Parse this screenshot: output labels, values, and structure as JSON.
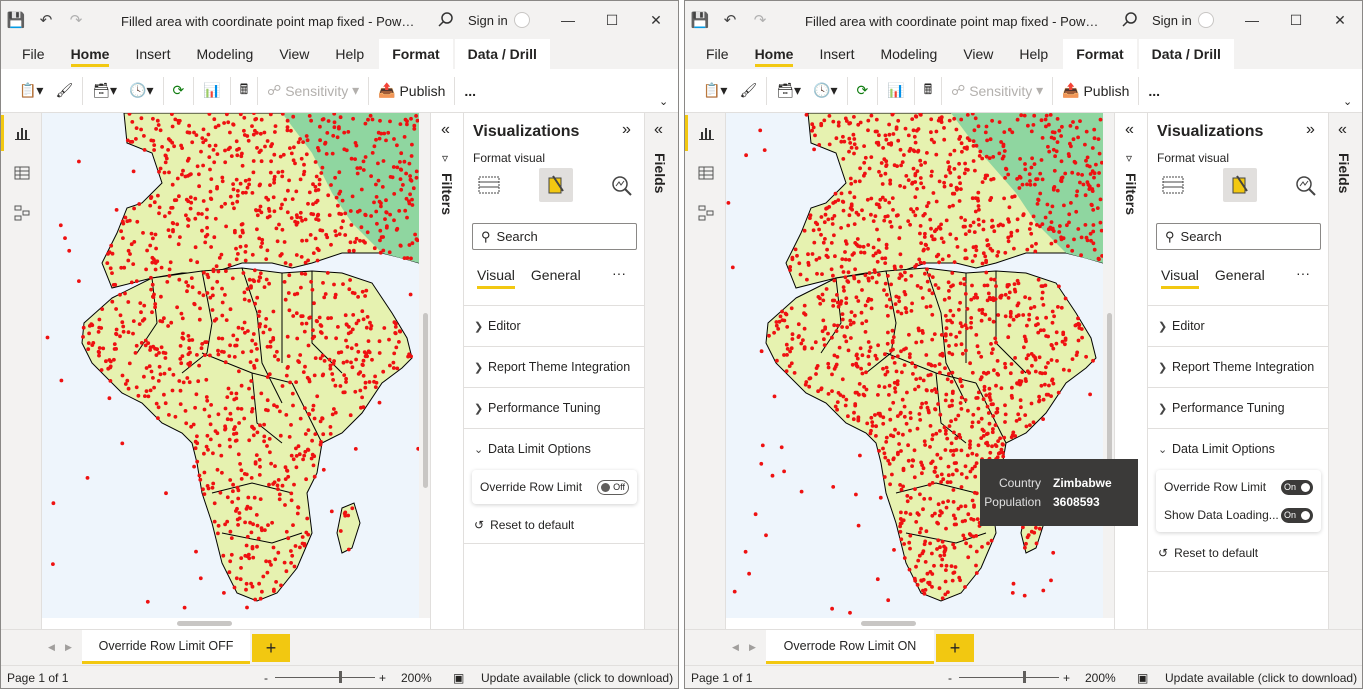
{
  "colors": {
    "accent": "#f2c811",
    "map_fill": "#e6f2b0",
    "map_fill_green": "#8fd6a0",
    "point": "#ee1111",
    "ocean": "#eef5fc"
  },
  "windows": [
    {
      "title": "Filled area with coordinate point map fixed - Power BI D...",
      "sign_in": "Sign in",
      "tabs": [
        "File",
        "Home",
        "Insert",
        "Modeling",
        "View",
        "Help",
        "Format",
        "Data / Drill"
      ],
      "ribbon": {
        "sensitivity": "Sensitivity",
        "publish": "Publish",
        "more": "..."
      },
      "filters_label": "Filters",
      "fields_label": "Fields",
      "viz": {
        "title": "Visualizations",
        "sub": "Format visual",
        "search": "Search",
        "tab_visual": "Visual",
        "tab_general": "General",
        "more": "···"
      },
      "sections": [
        "Editor",
        "Report Theme Integration",
        "Performance Tuning",
        "Data Limit Options"
      ],
      "options": [
        {
          "label": "Override Row Limit",
          "state": "Off"
        }
      ],
      "reset": "Reset to default",
      "page_tab": "Override Row Limit OFF",
      "add_page": "+",
      "status": {
        "page": "Page 1 of 1",
        "zoom": "200%",
        "update": "Update available (click to download)",
        "minus": "-",
        "plus": "+"
      }
    },
    {
      "title": "Filled area with coordinate point map fixed - Power BI D...",
      "sign_in": "Sign in",
      "tabs": [
        "File",
        "Home",
        "Insert",
        "Modeling",
        "View",
        "Help",
        "Format",
        "Data / Drill"
      ],
      "ribbon": {
        "sensitivity": "Sensitivity",
        "publish": "Publish",
        "more": "..."
      },
      "filters_label": "Filters",
      "fields_label": "Fields",
      "viz": {
        "title": "Visualizations",
        "sub": "Format visual",
        "search": "Search",
        "tab_visual": "Visual",
        "tab_general": "General",
        "more": "···"
      },
      "sections": [
        "Editor",
        "Report Theme Integration",
        "Performance Tuning",
        "Data Limit Options"
      ],
      "options": [
        {
          "label": "Override Row Limit",
          "state": "On"
        },
        {
          "label": "Show Data Loading...",
          "state": "On"
        }
      ],
      "reset": "Reset to default",
      "page_tab": "Overrode Row Limit ON",
      "add_page": "+",
      "status": {
        "page": "Page 1 of 1",
        "zoom": "200%",
        "update": "Update available (click to download)",
        "minus": "-",
        "plus": "+"
      },
      "tooltip": {
        "k1": "Country",
        "v1": "Zimbabwe",
        "k2": "Population",
        "v2": "3608593"
      }
    }
  ]
}
